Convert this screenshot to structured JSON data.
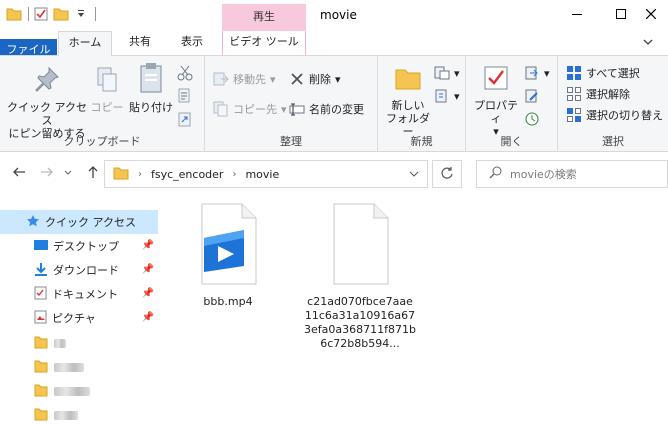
{
  "window": {
    "title": "movie",
    "context_tab_header": "再生",
    "controls": [
      "minimize",
      "maximize",
      "close"
    ]
  },
  "ribbon_tabs": {
    "file": "ファイル",
    "home": "ホーム",
    "share": "共有",
    "view": "表示",
    "video_tools": "ビデオ ツール"
  },
  "ribbon": {
    "clipboard": {
      "label": "クリップボード",
      "pin_quick_access": [
        "クイック アクセス",
        "にピン留めする"
      ],
      "copy": "コピー",
      "paste": "貼り付け"
    },
    "organize": {
      "label": "整理",
      "move_to": "移動先",
      "copy_to": "コピー先",
      "delete": "削除",
      "rename": "名前の変更"
    },
    "new": {
      "label": "新規",
      "new_folder": [
        "新しい",
        "フォルダー"
      ]
    },
    "open": {
      "label": "開く",
      "properties": "プロパティ"
    },
    "select": {
      "label": "選択",
      "select_all": "すべて選択",
      "select_none": "選択解除",
      "invert_selection": "選択の切り替え"
    }
  },
  "address": {
    "path": [
      "fsyc_encoder",
      "movie"
    ],
    "search_placeholder": "movieの検索"
  },
  "nav": {
    "quick_access": "クイック アクセス",
    "items": [
      {
        "label": "デスクトップ",
        "pinned": true
      },
      {
        "label": "ダウンロード",
        "pinned": true
      },
      {
        "label": "ドキュメント",
        "pinned": true
      },
      {
        "label": "ピクチャ",
        "pinned": true
      }
    ]
  },
  "files": [
    {
      "name": "bbb.mp4",
      "type": "video"
    },
    {
      "name": "c21ad070fbce7aae11c6a31a10916a673efa0a368711f871b6c72b8b594...",
      "type": "generic"
    }
  ],
  "colors": {
    "accent": "#1a66c2",
    "context_tab": "#f8c8dc",
    "selection": "#cce8ff"
  }
}
